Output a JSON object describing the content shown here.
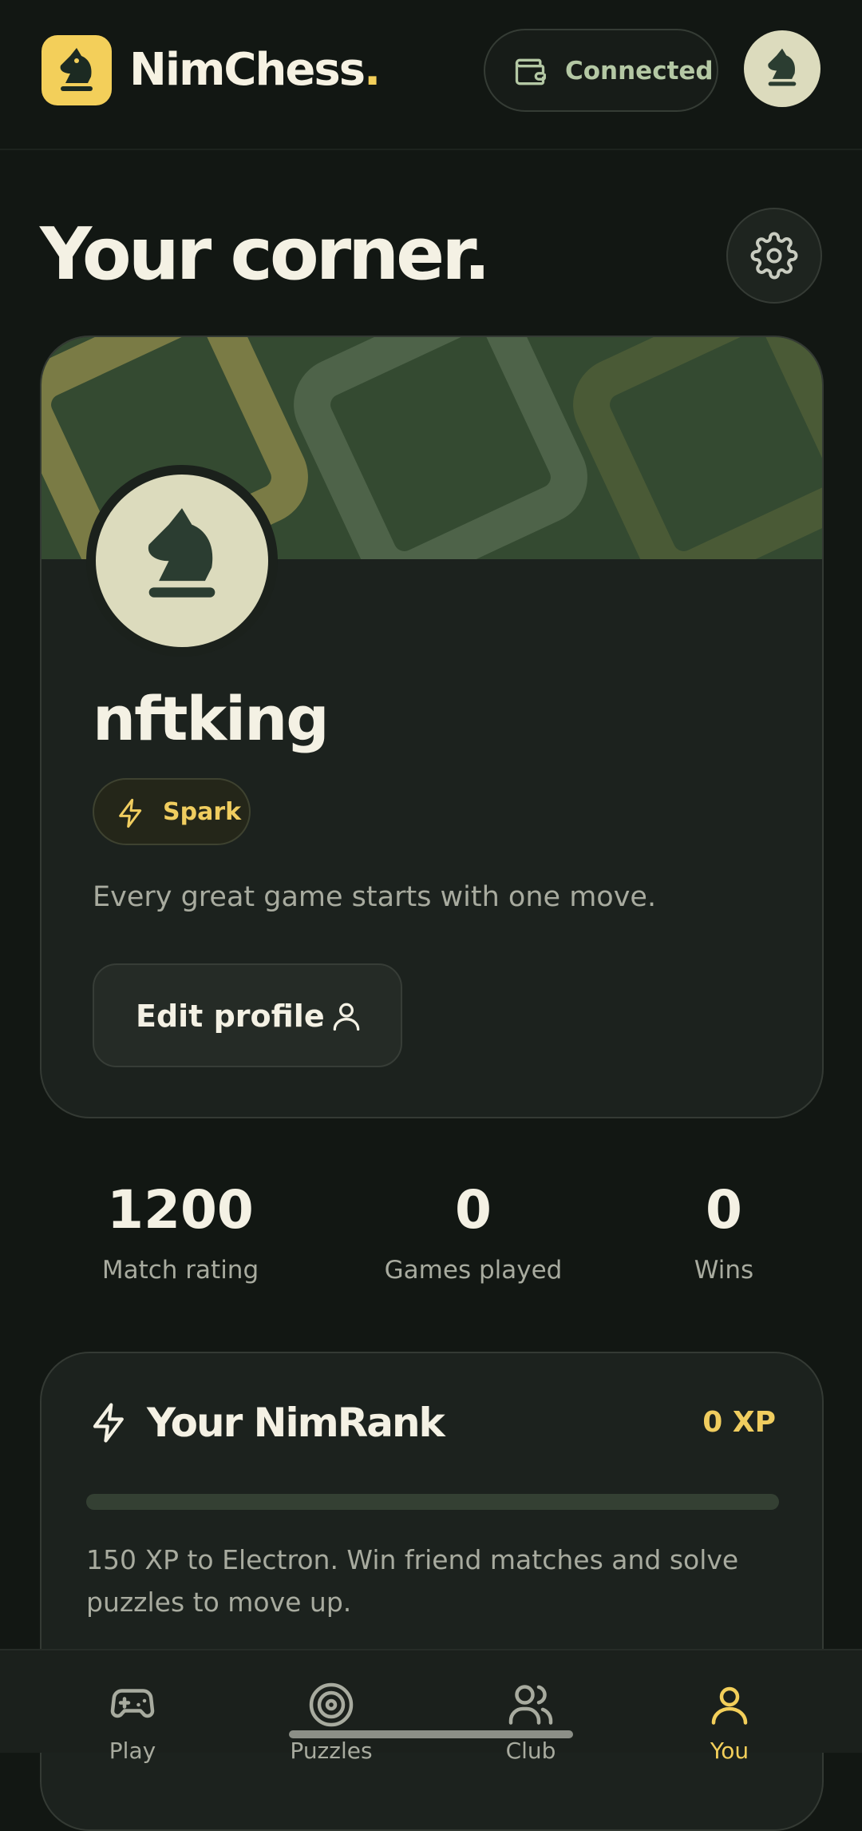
{
  "header": {
    "brand_name": "NimChess",
    "brand_dot": ".",
    "wallet_status": "Connected"
  },
  "page": {
    "title": "Your corner."
  },
  "profile": {
    "username": "nftking",
    "rank_badge": "Spark",
    "bio": "Every great game starts with one move.",
    "edit_label": "Edit profile"
  },
  "stats": [
    {
      "value": "1200",
      "label": "Match rating"
    },
    {
      "value": "0",
      "label": "Games played"
    },
    {
      "value": "0",
      "label": "Wins"
    }
  ],
  "nimrank": {
    "title": "Your NimRank",
    "xp": "0 XP",
    "progress": 0,
    "description": "150 XP to Electron. Win friend matches and solve puzzles to move up."
  },
  "nav": {
    "items": [
      {
        "label": "Play",
        "icon": "gamepad-icon",
        "active": false
      },
      {
        "label": "Puzzles",
        "icon": "target-icon",
        "active": false
      },
      {
        "label": "Club",
        "icon": "users-icon",
        "active": false
      },
      {
        "label": "You",
        "icon": "user-icon",
        "active": true
      }
    ]
  },
  "colors": {
    "accent": "#f3cf5a",
    "background": "#121713",
    "card": "#1c221e",
    "banner": "#344a31"
  }
}
